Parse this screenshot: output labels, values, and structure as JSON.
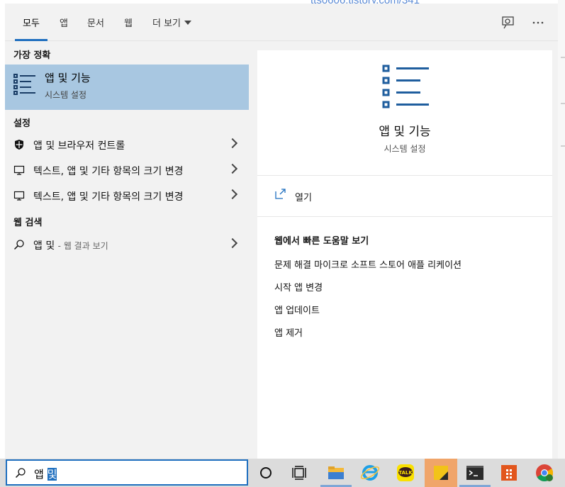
{
  "background": {
    "url_text": "tts0606.tistory.com/341"
  },
  "tabs": [
    {
      "label": "모두",
      "active": true
    },
    {
      "label": "앱"
    },
    {
      "label": "문서"
    },
    {
      "label": "웹"
    },
    {
      "label": "더 보기"
    }
  ],
  "top_icons": [
    "feedback-icon",
    "more-icon"
  ],
  "left": {
    "best_match_header": "가장 정확",
    "best_match": {
      "title": "앱 및 기능",
      "subtitle": "시스템 설정",
      "icon": "list-icon"
    },
    "settings_header": "설정",
    "settings": [
      {
        "label": "앱 및 브라우저 컨트롤",
        "icon": "shield-icon"
      },
      {
        "label": "텍스트, 앱 및 기타 항목의 크기 변경",
        "icon": "monitor-icon"
      },
      {
        "label": "텍스트, 앱 및 기타 항목의 크기 변경",
        "icon": "monitor-icon"
      }
    ],
    "web_header": "웹 검색",
    "web": {
      "label": "앱 및",
      "suffix": "- 웹 결과 보기",
      "icon": "search-icon"
    }
  },
  "right": {
    "title": "앱 및 기능",
    "subtitle": "시스템 설정",
    "open_label": "열기",
    "help_header": "웹에서 빠른 도움말 보기",
    "help_items": [
      "문제 해결 마이크로 소프트 스토어 애플 리케이션",
      "시작 앱 변경",
      "앱 업데이트",
      "앱 제거"
    ]
  },
  "taskbar": {
    "search_text_plain": "앱 ",
    "search_text_selected": "및",
    "icons": [
      "cortana-icon",
      "task-view-icon",
      "file-explorer-icon",
      "internet-explorer-icon",
      "kakaotalk-icon",
      "sticky-notes-icon",
      "terminal-icon",
      "office-icon",
      "chrome-icon"
    ],
    "kakao_label": "TALK"
  },
  "colors": {
    "accent": "#1f6fbf",
    "selected_row": "#a8c7e1",
    "panel_bg": "#f2f2f2"
  }
}
